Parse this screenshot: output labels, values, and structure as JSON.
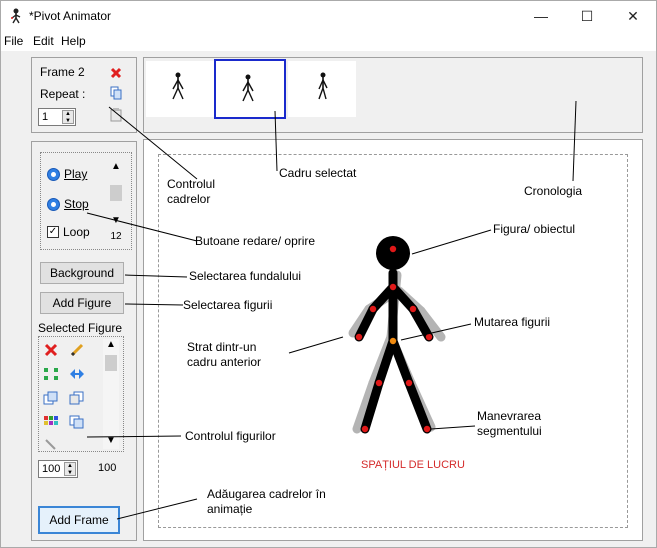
{
  "window": {
    "title": "*Pivot Animator",
    "minimize_glyph": "—",
    "maximize_glyph": "☐",
    "close_glyph": "✕"
  },
  "menu": [
    "File",
    "Edit",
    "Help"
  ],
  "frame_control": {
    "frame_label": "Frame 2",
    "repeat_label": "Repeat :",
    "repeat_value": "1"
  },
  "playback": {
    "play_label": "Play",
    "stop_label": "Stop",
    "loop_label": "Loop",
    "loop_checked": true,
    "speed_value": "12"
  },
  "buttons": {
    "background": "Background",
    "add_figure": "Add Figure",
    "add_frame": "Add Frame"
  },
  "selected_figure": {
    "label": "Selected Figure",
    "size_value": "100",
    "size_readout": "100"
  },
  "annotations": {
    "frame_control": "Controlul\ncadrelor",
    "selected_frame": "Cadru selectat",
    "timeline": "Cronologia",
    "play_stop": "Butoane redare/ oprire",
    "background_select": "Selectarea fundalului",
    "figure_select": "Selectarea figurii",
    "figure_object": "Figura/ obiectul",
    "move_figure": "Mutarea figurii",
    "previous_layer": "Strat dintr-un\ncadru anterior",
    "segment_handling": "Manevrarea\nsegmentului",
    "figure_controls": "Controlul figurilor",
    "workspace": "SPAȚIUL DE LUCRU",
    "add_frames": "Adăugarea cadrelor în\nanimație"
  },
  "icons": {
    "app": "stick-figure-icon",
    "delete": "red-x-icon",
    "edit": "pencil-icon",
    "accent_blue": "#1a2acc",
    "joint_red": "#e01818",
    "center_orange": "#f08a10"
  }
}
